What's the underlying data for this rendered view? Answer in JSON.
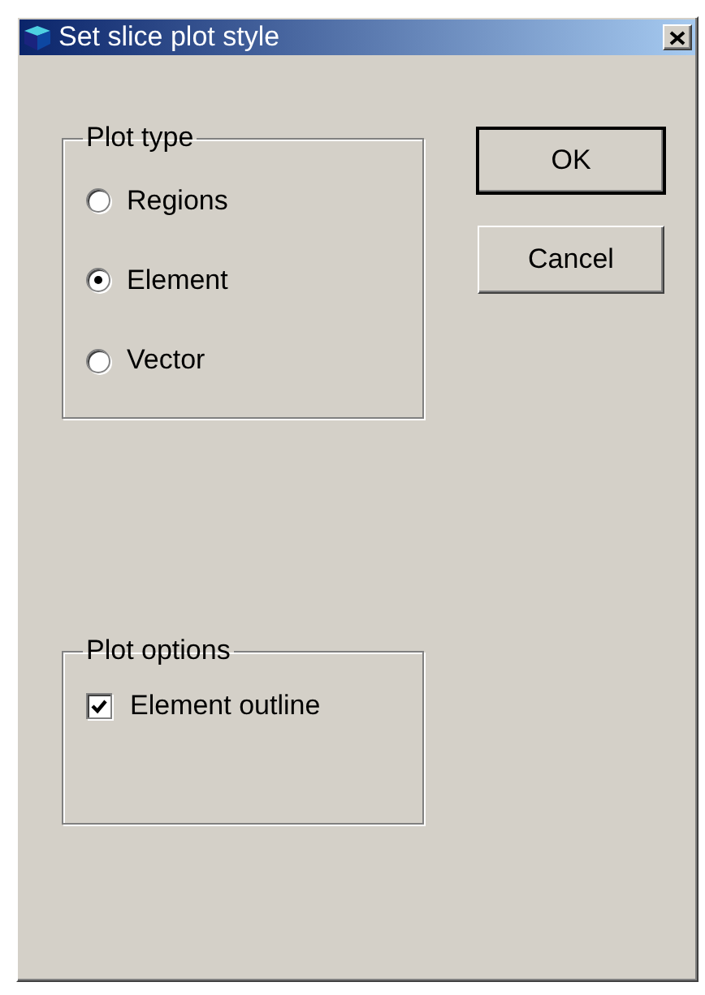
{
  "window": {
    "title": "Set slice plot style"
  },
  "plot_type": {
    "label": "Plot type",
    "options": [
      {
        "label": "Regions",
        "selected": false
      },
      {
        "label": "Element",
        "selected": true
      },
      {
        "label": "Vector",
        "selected": false
      }
    ]
  },
  "plot_options": {
    "label": "Plot options",
    "options": [
      {
        "label": "Element outline",
        "checked": true
      }
    ]
  },
  "buttons": [
    {
      "label": "OK",
      "default": true
    },
    {
      "label": "Cancel",
      "default": false
    }
  ]
}
